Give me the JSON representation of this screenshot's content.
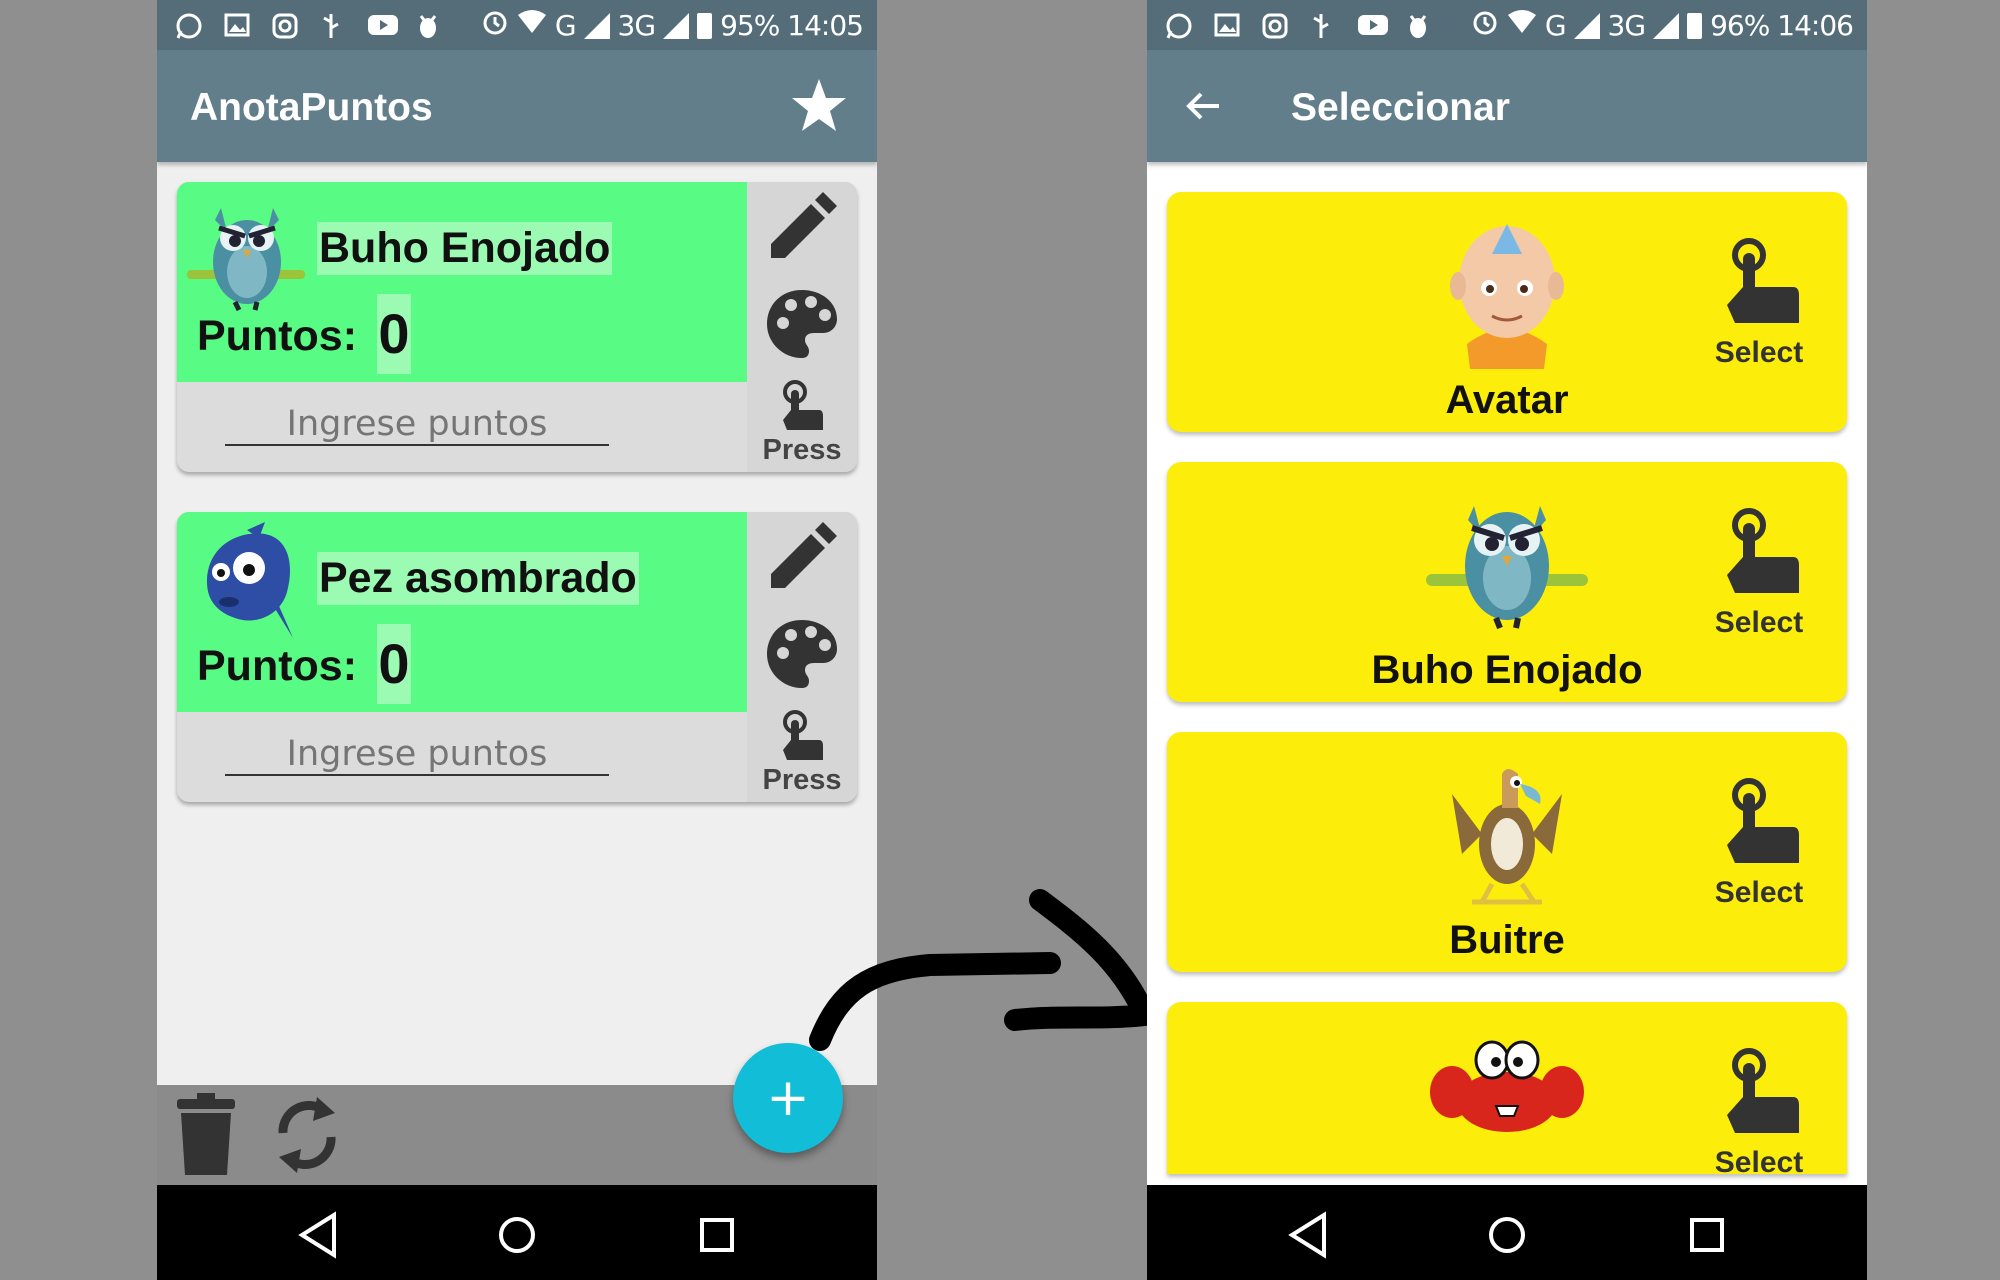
{
  "left_screen": {
    "status_time": "14:05",
    "status_battery": "95%",
    "status_network": "G",
    "status_network2": "3G",
    "app_title": "AnotaPuntos",
    "cards": [
      {
        "name": "Buho Enojado",
        "points_label": "Puntos:",
        "points": "0",
        "input_placeholder": "Ingrese puntos",
        "press_label": "Press",
        "avatar": "owl"
      },
      {
        "name": "Pez asombrado",
        "points_label": "Puntos:",
        "points": "0",
        "input_placeholder": "Ingrese puntos",
        "press_label": "Press",
        "avatar": "fish"
      }
    ],
    "fab_label": "+"
  },
  "right_screen": {
    "status_time": "14:06",
    "status_battery": "96%",
    "status_network": "G",
    "status_network2": "3G",
    "app_title": "Seleccionar",
    "items": [
      {
        "name": "Avatar",
        "select_label": "Select",
        "image": "avatar-boy"
      },
      {
        "name": "Buho Enojado",
        "select_label": "Select",
        "image": "owl"
      },
      {
        "name": "Buitre",
        "select_label": "Select",
        "image": "vulture"
      },
      {
        "name": "",
        "select_label": "Select",
        "image": "crab"
      }
    ]
  },
  "colors": {
    "appbar": "#627e8b",
    "statusbar": "#546d79",
    "card_green": "#58fb84",
    "card_yellow": "#fcee0a",
    "fab": "#12bdd7"
  }
}
